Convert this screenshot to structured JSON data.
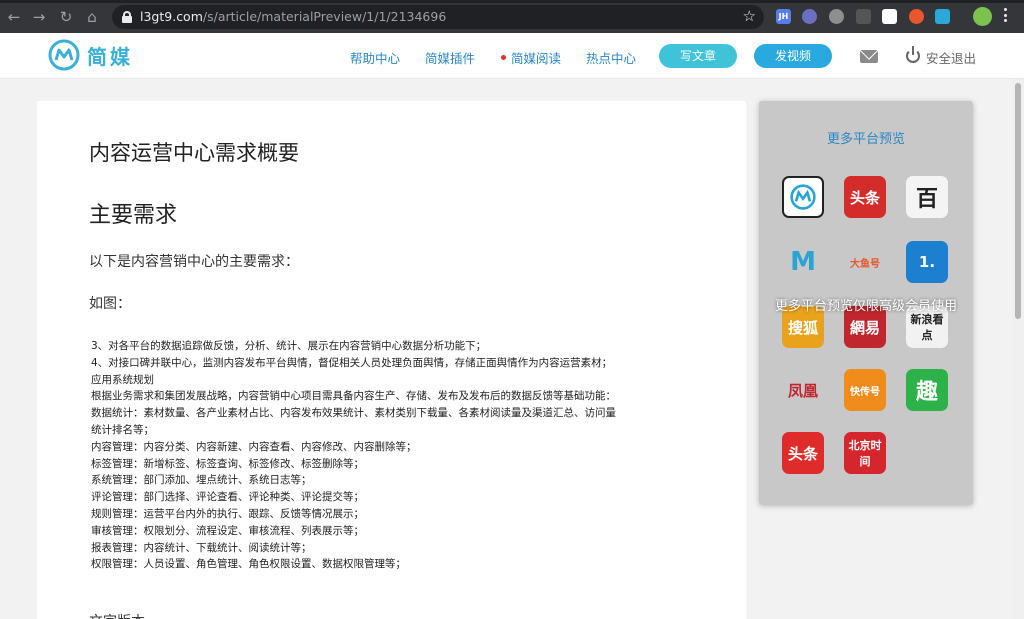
{
  "browser": {
    "url_host": "l3gt9.com",
    "url_path": "/s/article/materialPreview/1/1/2134696",
    "ext_jh": "JH"
  },
  "site": {
    "logo_text": "简媒",
    "nav": [
      "帮助中心",
      "简媒插件",
      "简媒阅读",
      "热点中心"
    ],
    "write_btn": "写文章",
    "video_btn": "发视频",
    "logout": "安全退出",
    "accent": "#3bb0d6"
  },
  "article": {
    "title": "内容运营中心需求概要",
    "h2": "主要需求",
    "intro": "以下是内容营销中心的主要需求：",
    "figure_label": "如图：",
    "lines": [
      "3、对各平台的数据追踪做反馈，分析、统计、展示在内容营销中心数据分析功能下；",
      "4、对接口碑并联中心，监测内容发布平台舆情，督促相关人员处理负面舆情，存储正面舆情作为内容运营素材；",
      "应用系统规划",
      "根据业务需求和集团发展战略，内容营销中心项目需具备内容生产、存储、发布及发布后的数据反馈等基础功能：",
      "数据统计：素材数量、各产业素材占比、内容发布效果统计、素材类别下载量、各素材阅读量及渠道汇总、访问量",
      "统计排名等；",
      "内容管理：内容分类、内容新建、内容查看、内容修改、内容删除等；",
      "标签管理：新增标签、标签查询、标签修改、标签删除等；",
      "系统管理：部门添加、埋点统计、系统日志等；",
      "评论管理：部门选择、评论查看、评论种类、评论提交等；",
      "规则管理：运营平台内外的执行、跟踪、反馈等情况展示；",
      "审核管理：权限划分、流程设定、审核流程、列表展示等；",
      "报表管理：内容统计、下载统计、阅读统计等；",
      "权限管理：人员设置、角色管理、角色权限设置、数据权限管理等；"
    ],
    "partial_line": "文字版本"
  },
  "side": {
    "title": "更多平台预览",
    "overlay": "更多平台预览仅限高级会员使用",
    "platforms": [
      {
        "label": "",
        "icon": "jianmei-logo-icon",
        "bg": "#ffffff"
      },
      {
        "label": "头条",
        "icon": "toutiao-icon",
        "bg": "#d42b2b"
      },
      {
        "label": "百",
        "icon": "baijiahao-icon",
        "bg": "#f4f4f4"
      },
      {
        "label": "M",
        "icon": "m-logo-icon",
        "bg": "#c8c8c8"
      },
      {
        "label": "大鱼号",
        "icon": "dayu-icon",
        "bg": "#c8c8c8"
      },
      {
        "label": "1.",
        "icon": "yidian-icon",
        "bg": "#1c7fd0"
      },
      {
        "label": "搜狐",
        "icon": "sohu-icon",
        "bg": "#e8a21c"
      },
      {
        "label": "網易",
        "icon": "netease-icon",
        "bg": "#c0262d"
      },
      {
        "label": "新浪看点",
        "icon": "sina-icon",
        "bg": "#f2f2f2"
      },
      {
        "label": "凤凰",
        "icon": "ifeng-icon",
        "bg": "#c8c8c8"
      },
      {
        "label": "快传号",
        "icon": "kuaichuan-icon",
        "bg": "#f08c1c"
      },
      {
        "label": "趣",
        "icon": "qutoutiao-icon",
        "bg": "#2db24a"
      },
      {
        "label": "头条",
        "icon": "toutiao-red-icon",
        "bg": "#e02b2b"
      },
      {
        "label": "北京时间",
        "icon": "bjtime-icon",
        "bg": "#d6262d"
      }
    ]
  }
}
